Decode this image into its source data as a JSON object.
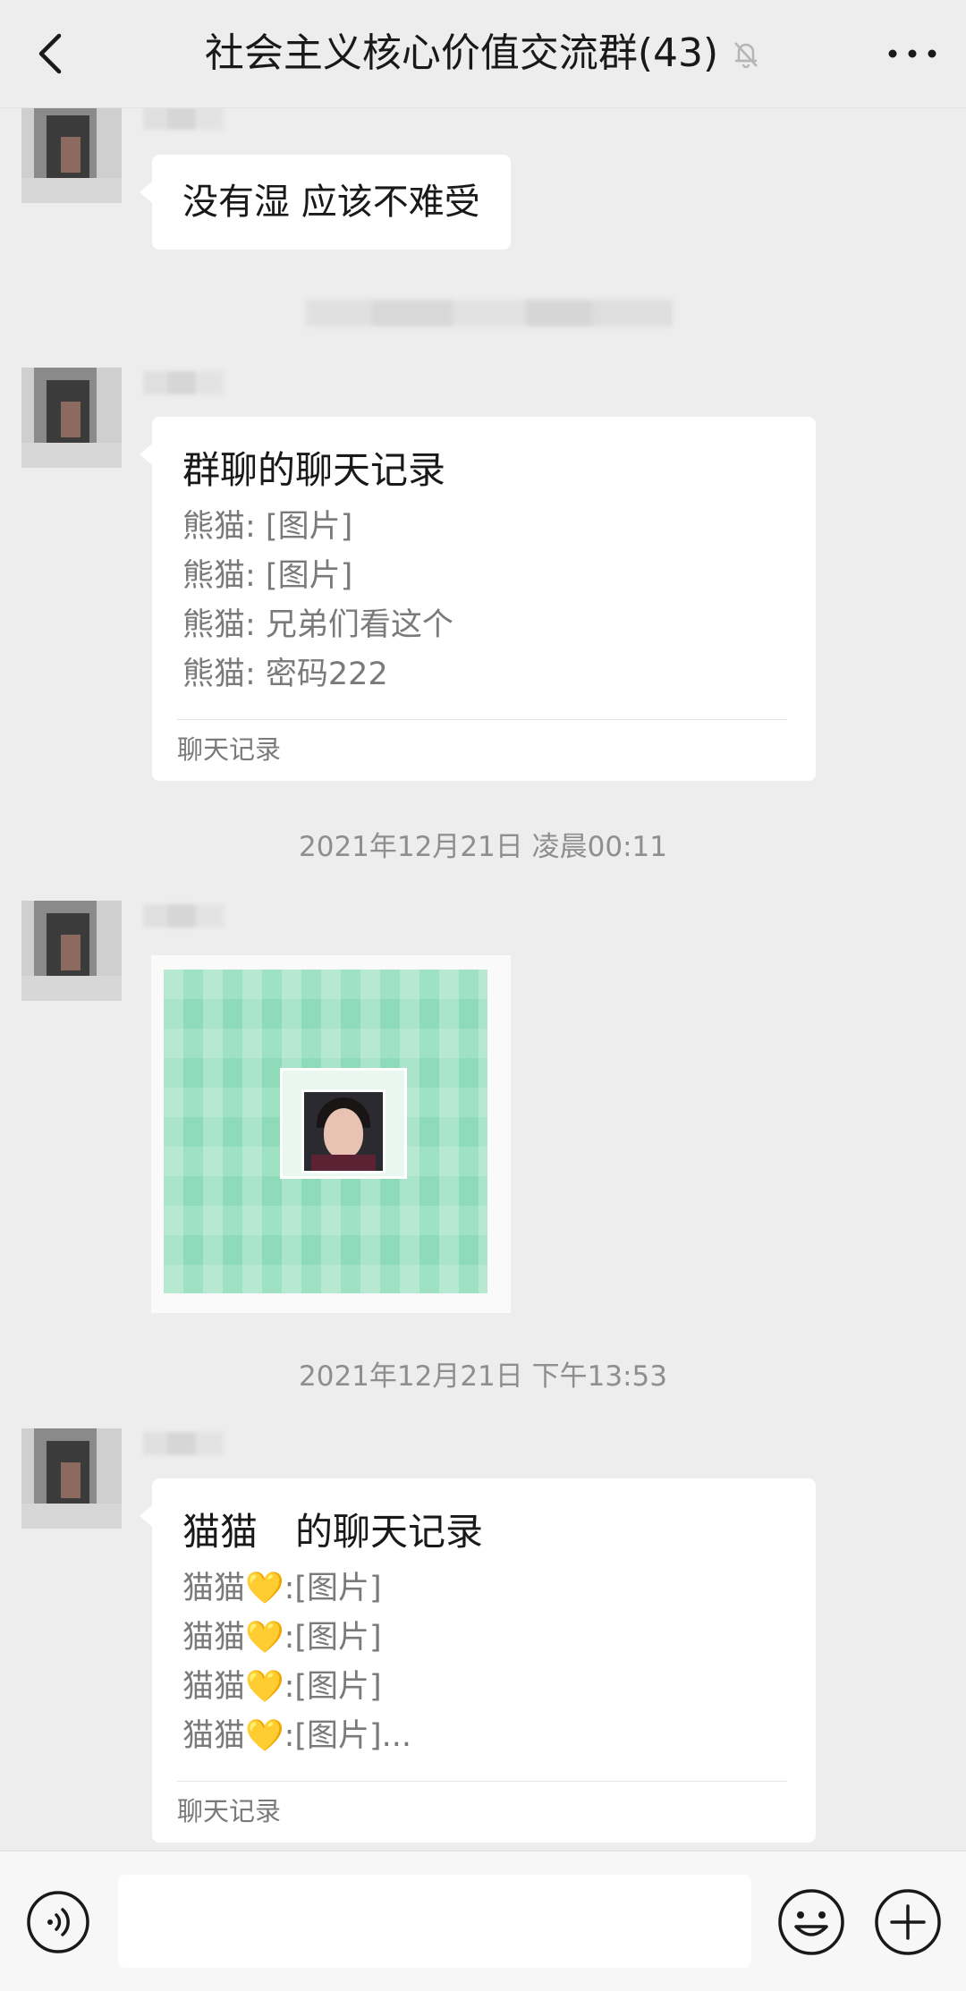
{
  "header": {
    "title": "社会主义核心价值交流群(43)",
    "back_icon": "chevron-left-icon",
    "mute_icon": "bell-off-icon",
    "more_icon": "more-dots-icon"
  },
  "messages": [
    {
      "type": "text",
      "text": "没有湿 应该不难受"
    },
    {
      "type": "chat_record",
      "title": "群聊的聊天记录",
      "lines": [
        "熊猫: [图片]",
        "熊猫: [图片]",
        "熊猫: 兄弟们看这个",
        "熊猫: 密码222"
      ],
      "footer": "聊天记录"
    },
    {
      "type": "timestamp",
      "text": "2021年12月21日 凌晨00:11"
    },
    {
      "type": "image",
      "description": "qr-code-image"
    },
    {
      "type": "timestamp",
      "text": "2021年12月21日 下午13:53"
    },
    {
      "type": "chat_record",
      "title": "猫猫　的聊天记录",
      "lines": [
        "猫猫💛:[图片]",
        "猫猫💛:[图片]",
        "猫猫💛:[图片]",
        "猫猫💛:[图片]..."
      ],
      "footer": "聊天记录"
    }
  ],
  "input_bar": {
    "voice_icon": "voice-icon",
    "input_value": "",
    "emoji_icon": "emoji-icon",
    "plus_icon": "plus-icon"
  },
  "colors": {
    "background": "#ededed",
    "bubble": "#ffffff",
    "secondary_text": "#7a7a7a",
    "qr_green": "#9fe2c3"
  }
}
